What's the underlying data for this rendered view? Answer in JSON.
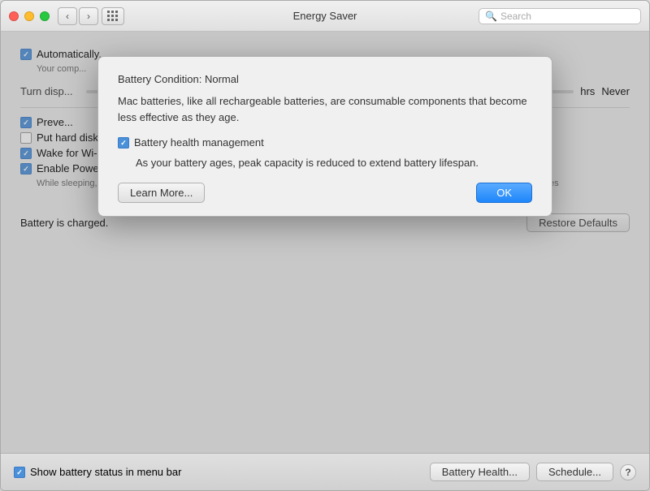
{
  "window": {
    "title": "Energy Saver",
    "search_placeholder": "Search"
  },
  "titlebar": {
    "back_label": "‹",
    "forward_label": "›"
  },
  "background": {
    "automatically_label": "Automatically...",
    "your_comp_label": "Your comp...",
    "turn_display_label": "Turn disp...",
    "hrs_label": "hrs",
    "never_label": "Never",
    "prevent_label": "Preve...",
    "put_hard_disks_label": "Put hard disks to sleep when possible",
    "wake_wifi_label": "Wake for Wi-Fi network access",
    "enable_power_nap_label": "Enable Power Nap while plugged into a power adapter",
    "enable_power_nap_desc": "While sleeping, your Mac can back up using Time Machine and periodically check for new email,\ncalendar, and other iCloud updates",
    "battery_charged_label": "Battery is charged.",
    "restore_defaults_label": "Restore Defaults",
    "show_battery_label": "Show battery status in menu bar",
    "battery_health_label": "Battery Health...",
    "schedule_label": "Schedule...",
    "help_label": "?"
  },
  "modal": {
    "condition_label": "Battery Condition:",
    "condition_value": "Normal",
    "description": "Mac batteries, like all rechargeable batteries, are consumable\ncomponents that become less effective as they age.",
    "health_mgmt_label": "Battery health management",
    "health_mgmt_desc": "As your battery ages, peak capacity is reduced to extend\nbattery lifespan.",
    "learn_more_label": "Learn More...",
    "ok_label": "OK"
  },
  "checkboxes": {
    "automatically_checked": true,
    "prevent_checked": true,
    "put_hard_disks_checked": false,
    "wake_wifi_checked": true,
    "enable_power_nap_checked": true,
    "show_battery_checked": true,
    "battery_health_mgmt_checked": true
  }
}
